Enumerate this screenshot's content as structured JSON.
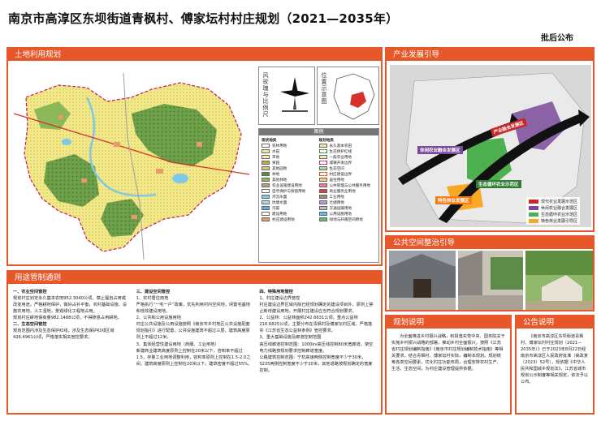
{
  "header": {
    "title": "南京市高淳区东坝街道青枫村、傅家坛村村庄规划（2021—2035年）",
    "approval": "批后公布"
  },
  "land_use": {
    "heading": "土地利用规划",
    "wind_label": "风玫瑰与比例尺",
    "location_label": "位置示意图",
    "legend_title": "图例",
    "legend_col1_head": "现状地类",
    "legend_col2_head": "规划地类",
    "legend_col1": [
      "农林用地",
      "水田",
      "旱地",
      "果园",
      "其他园地",
      "林地",
      "其他林地",
      "农业设施建设用地",
      "自然保护与保留用地",
      "河流水面",
      "坑塘水面",
      "沟渠",
      "建设用地",
      "村庄建设用地"
    ],
    "legend_col2": [
      "永久基本农田",
      "生态保护红线",
      "一般农业用地",
      "城镇开发边界",
      "生态空间",
      "村庄建设边界",
      "居住用地",
      "公共管理与公共服务用地",
      "商业服务业用地",
      "工业用地",
      "仓储用地",
      "交通运输用地",
      "公用设施用地",
      "绿地与开敞空间用地"
    ]
  },
  "industry": {
    "heading": "产业发展引导",
    "labels": [
      "休闲农业融合发展区",
      "产业融合发展区",
      "生态循环农业示范区",
      "特色林业发展区"
    ],
    "legend": [
      "现代农业发展示范区",
      "休闲农业融合发展区",
      "生态循环农业示范区",
      "特色林业发展引导区"
    ]
  },
  "public_space": {
    "heading": "公共空间整治引导"
  },
  "usage": {
    "heading": "用途管制通则",
    "col1": [
      "一、农业空间管控",
      "规划村庄划定永久基本农田952.3040公顷。禁止擅自占用或改变用途。严格耕地保护，做好占补平衡，农村基础设施、设施农用地，人工湿地，景观绿化工程地占用。",
      "规划村庄耕地保有量982.1488公顷，不得随意占用耕地。",
      "二、生态空间管控",
      "规划范围内涉及生态保护红线，涉及生态保护红线区域426.4961公顷，严格落实相关管控要求。"
    ],
    "col2": [
      "三、建设空间管控",
      "1、农村居住用地",
      "严格执行“一宅一户”政策，优先利用村内空闲地，闲置宅基地和低效建设用地。",
      "2、公共和公用设施用地",
      "村庄公共设施及公用设施按照《南京市乡村地区公共设施配套规划指引》进行配置，公共设施建筑不超过三层，建筑高度原则上不超过12米。",
      "3、集体经营性建设用地（商服、工业用地）",
      "新建商业建筑高度原则上控制在20米以下，容积率不超过1.5，存量工业用地调整利用，容积率原则上控制在1.5-2.0之间，建筑高度原则上控制在20米以下，建筑密度不超过55%。"
    ],
    "col3": [
      "四、特殊用地管控",
      "1、村庄建设边界管控",
      "村庄建设边界区域内除已经规划确定的建设项目外，原则上禁止新增建设用地，开展村庄建设应当符合规划要求。",
      "2、公益林：公益林面积242.6631公顷。重点公益林216.6825公顷，主要分布在青枫村及傅家坛村区域，严格落实《江苏省生态公益林条例》管控要求。",
      "3、重大基础设施及廊道控制范围",
      "高压线廊道控制范围：1000kv高压线控制80米宽廊道，架空电力线路按规划要求控制廊道宽度。",
      "公路建筑控制范围：宁杭高速两侧控制宽度不少于30米，S235两侧控制宽度不少于20米，其他道路按规划确定的宽度控制。"
    ]
  },
  "planning": {
    "heading": "规划说明",
    "text": "为全面推进乡村振兴战略，积极落实党中央、国务院关于实施乡村振兴战略的部署，推动乡村全面振兴，按照《江苏省村庄规划编制指南》《南京市村庄规划编制技术指南》等相关要求，结合青枫村、傅家坛村实际，编制本规划。规划统筹各类空间要素，优化村庄功能布局，合理安排农村生产、生活、生态空间，为村庄建设管理提供依据。"
  },
  "notice": {
    "heading": "公告说明",
    "text": "《南京市高淳区东坝街道青枫村、傅家坛村村庄规划（2021—2035年）》已于2023年8月22日经南京市高淳区人民政府批准（高政复〔2023〕52号），现依据《中华人民共和国城乡规划法》、江苏省城市规划公示制度等相关规定，依法予以公布。"
  },
  "colors": {
    "accent": "#e8572a",
    "forest": "#5a8f3a",
    "farmland": "#f2e98a",
    "water": "#7ec8e8"
  }
}
